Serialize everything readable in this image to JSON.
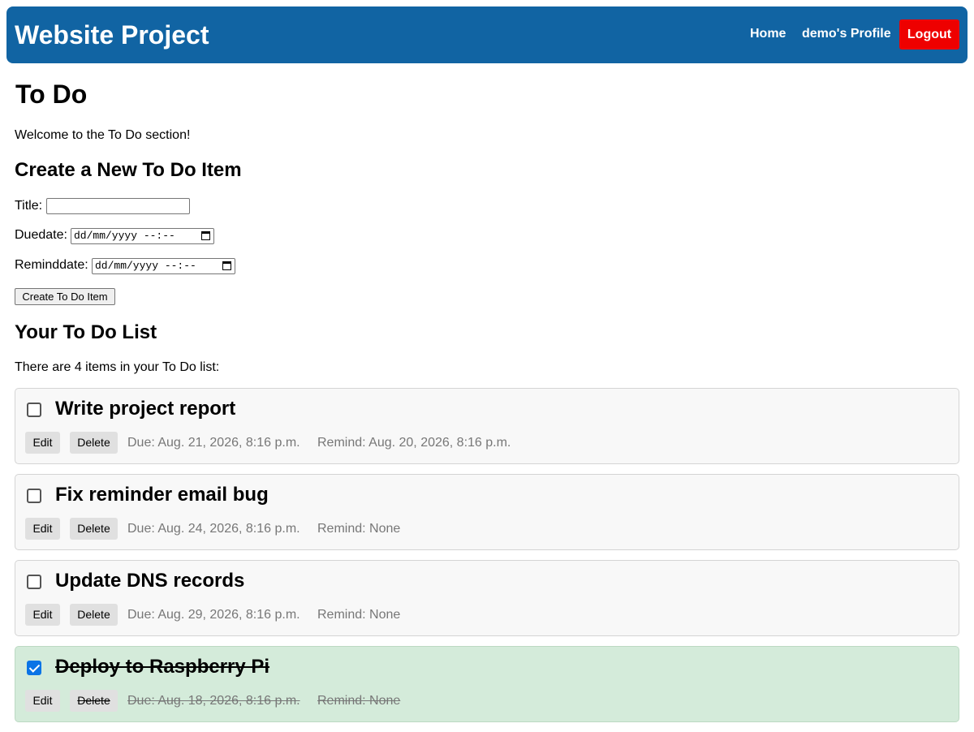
{
  "header": {
    "brand": "Website Project",
    "nav": {
      "home": "Home",
      "profile": "demo's Profile",
      "logout": "Logout"
    }
  },
  "page": {
    "title": "To Do",
    "welcome": "Welcome to the To Do section!"
  },
  "create_form": {
    "heading": "Create a New To Do Item",
    "title_label": "Title:",
    "title_value": "",
    "duedate_label": "Duedate:",
    "duedate_placeholder": "dd/mm/yyyy --:--",
    "reminddate_label": "Reminddate:",
    "reminddate_placeholder": "dd/mm/yyyy --:--",
    "submit_label": "Create To Do Item"
  },
  "list": {
    "heading": "Your To Do List",
    "count_text": "There are 4 items in your To Do list:",
    "edit_label": "Edit",
    "delete_label": "Delete",
    "items": [
      {
        "title": "Write project report",
        "due": "Due: Aug. 21, 2026, 8:16 p.m.",
        "remind": "Remind: Aug. 20, 2026, 8:16 p.m.",
        "completed": false
      },
      {
        "title": "Fix reminder email bug",
        "due": "Due: Aug. 24, 2026, 8:16 p.m.",
        "remind": "Remind: None",
        "completed": false
      },
      {
        "title": "Update DNS records",
        "due": "Due: Aug. 29, 2026, 8:16 p.m.",
        "remind": "Remind: None",
        "completed": false
      },
      {
        "title": "Deploy to Raspberry Pi",
        "due": "Due: Aug. 18, 2026, 8:16 p.m.",
        "remind": "Remind: None",
        "completed": true
      }
    ]
  },
  "colors": {
    "header_bg": "#1164a3",
    "logout_bg": "#ee0000",
    "completed_bg": "#d4ebda",
    "checkbox_checked": "#0b74e6"
  }
}
